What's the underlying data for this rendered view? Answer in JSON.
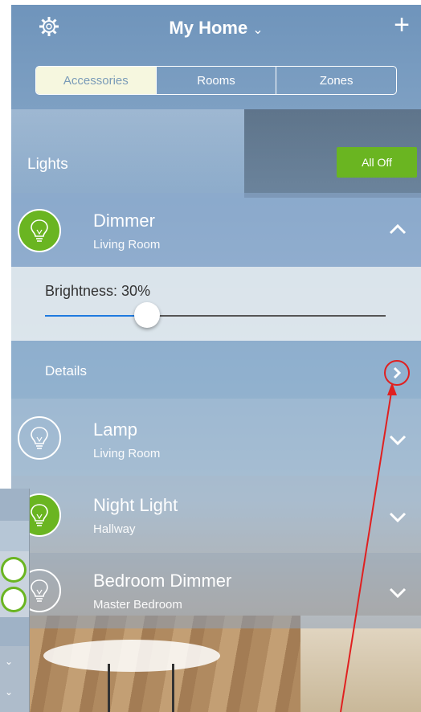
{
  "header": {
    "title": "My Home",
    "title_chevron": "⌄",
    "settings_icon": "gear-icon",
    "add_label": "+"
  },
  "tabs": [
    {
      "label": "Accessories",
      "selected": true
    },
    {
      "label": "Rooms",
      "selected": false
    },
    {
      "label": "Zones",
      "selected": false
    }
  ],
  "section": {
    "label": "Lights",
    "all_off_label": "All Off"
  },
  "accessories": [
    {
      "name": "Dimmer",
      "room": "Living Room",
      "on": true,
      "expanded": true
    },
    {
      "name": "Lamp",
      "room": "Living Room",
      "on": false,
      "expanded": false
    },
    {
      "name": "Night Light",
      "room": "Hallway",
      "on": true,
      "expanded": false
    },
    {
      "name": "Bedroom Dimmer",
      "room": "Master Bedroom",
      "on": false,
      "expanded": false
    }
  ],
  "brightness": {
    "label": "Brightness: 30%",
    "value": 0.3
  },
  "details": {
    "label": "Details"
  },
  "colors": {
    "accent_green": "#6ab521",
    "slider_blue": "#1f7ae0",
    "annotation_red": "#e02020"
  }
}
